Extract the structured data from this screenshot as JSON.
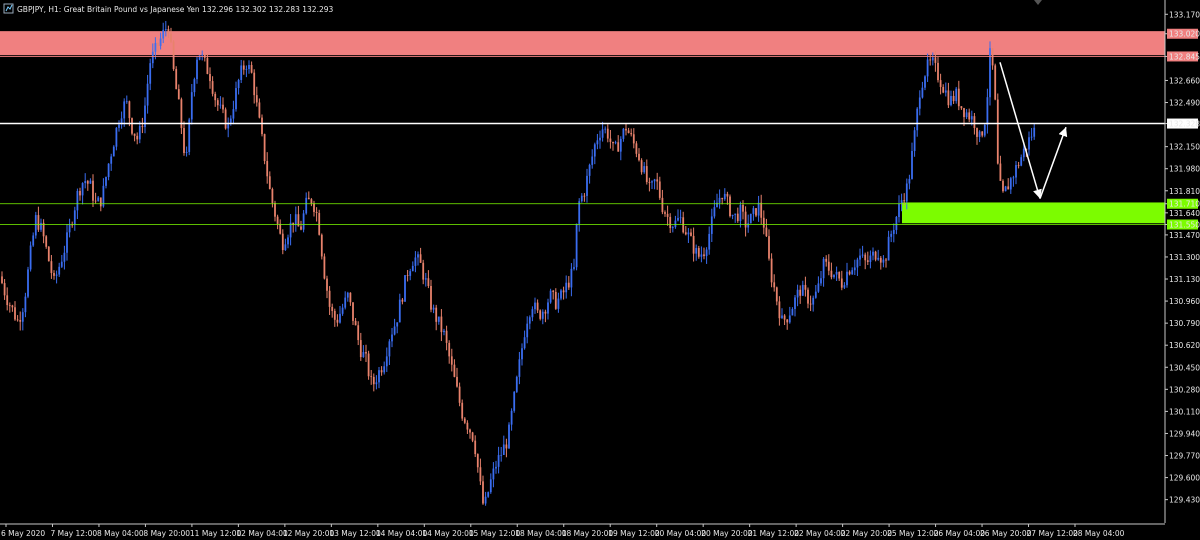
{
  "window": {
    "title": "GBPJPY, H1:  Great Britain Pound vs Japanese Yen  132.296 132.302 132.283 132.293"
  },
  "colors": {
    "background": "#000000",
    "bull_candle": "#3a6df0",
    "bear_candle": "#e8826c",
    "resistance_zone": "#f08080",
    "support_zone": "#7cfc00",
    "current_price_line": "#ffffff",
    "axis_text": "#e8e8e8",
    "axis_line": "#c8c8c8"
  },
  "chart_data": {
    "type": "candlestick",
    "title": "GBPJPY, H1:  Great Britain Pound vs Japanese Yen  132.296 132.302 132.283 132.293",
    "xlabel": "",
    "ylabel": "",
    "ylim": [
      129.25,
      133.28
    ],
    "y_ticks": [
      "133.170",
      "133.020",
      "132.845",
      "132.660",
      "132.490",
      "132.328",
      "132.150",
      "131.980",
      "131.810",
      "131.710",
      "131.640",
      "131.550",
      "131.470",
      "131.300",
      "131.130",
      "130.960",
      "130.790",
      "130.620",
      "130.450",
      "130.280",
      "130.110",
      "129.940",
      "129.770",
      "129.600",
      "129.430"
    ],
    "y_tick_values": [
      133.17,
      133.02,
      132.845,
      132.66,
      132.49,
      132.328,
      132.15,
      131.98,
      131.81,
      131.71,
      131.64,
      131.55,
      131.47,
      131.3,
      131.13,
      130.96,
      130.79,
      130.62,
      130.45,
      130.28,
      130.11,
      129.94,
      129.77,
      129.6,
      129.43
    ],
    "x_ticks": [
      "6 May 2020",
      "7 May 12:00",
      "8 May 04:00",
      "8 May 20:00",
      "11 May 12:00",
      "12 May 04:00",
      "12 May 20:00",
      "13 May 12:00",
      "14 May 04:00",
      "14 May 20:00",
      "15 May 12:00",
      "18 May 04:00",
      "18 May 20:00",
      "19 May 12:00",
      "20 May 04:00",
      "20 May 20:00",
      "21 May 12:00",
      "22 May 04:00",
      "22 May 20:00",
      "25 May 12:00",
      "26 May 04:00",
      "26 May 20:00",
      "27 May 12:00",
      "28 May 04:00"
    ],
    "close_path": [
      [
        0,
        131.15
      ],
      [
        6,
        131.0
      ],
      [
        12,
        130.9
      ],
      [
        18,
        130.8
      ],
      [
        24,
        130.95
      ],
      [
        30,
        131.3
      ],
      [
        36,
        131.6
      ],
      [
        42,
        131.5
      ],
      [
        48,
        131.3
      ],
      [
        54,
        131.1
      ],
      [
        60,
        131.25
      ],
      [
        66,
        131.4
      ],
      [
        72,
        131.6
      ],
      [
        78,
        131.8
      ],
      [
        84,
        131.9
      ],
      [
        90,
        131.85
      ],
      [
        96,
        131.7
      ],
      [
        102,
        131.75
      ],
      [
        108,
        132.0
      ],
      [
        114,
        132.2
      ],
      [
        120,
        132.4
      ],
      [
        126,
        132.5
      ],
      [
        132,
        132.3
      ],
      [
        138,
        132.2
      ],
      [
        144,
        132.4
      ],
      [
        150,
        132.8
      ],
      [
        156,
        132.9
      ],
      [
        162,
        133.0
      ],
      [
        168,
        133.1
      ],
      [
        174,
        132.7
      ],
      [
        180,
        132.4
      ],
      [
        186,
        132.0
      ],
      [
        192,
        132.6
      ],
      [
        198,
        132.9
      ],
      [
        204,
        132.8
      ],
      [
        210,
        132.7
      ],
      [
        216,
        132.5
      ],
      [
        222,
        132.4
      ],
      [
        228,
        132.3
      ],
      [
        234,
        132.5
      ],
      [
        240,
        132.7
      ],
      [
        246,
        132.8
      ],
      [
        252,
        132.7
      ],
      [
        258,
        132.4
      ],
      [
        264,
        132.1
      ],
      [
        270,
        131.8
      ],
      [
        276,
        131.6
      ],
      [
        282,
        131.4
      ],
      [
        288,
        131.5
      ],
      [
        294,
        131.6
      ],
      [
        300,
        131.5
      ],
      [
        306,
        131.7
      ],
      [
        312,
        131.75
      ],
      [
        318,
        131.6
      ],
      [
        324,
        131.2
      ],
      [
        330,
        130.9
      ],
      [
        336,
        130.8
      ],
      [
        342,
        130.9
      ],
      [
        348,
        131.0
      ],
      [
        354,
        130.8
      ],
      [
        360,
        130.6
      ],
      [
        366,
        130.5
      ],
      [
        372,
        130.3
      ],
      [
        378,
        130.4
      ],
      [
        384,
        130.5
      ],
      [
        390,
        130.7
      ],
      [
        396,
        130.8
      ],
      [
        402,
        131.0
      ],
      [
        408,
        131.2
      ],
      [
        414,
        131.3
      ],
      [
        420,
        131.25
      ],
      [
        426,
        131.1
      ],
      [
        432,
        130.9
      ],
      [
        438,
        130.8
      ],
      [
        444,
        130.7
      ],
      [
        450,
        130.5
      ],
      [
        456,
        130.3
      ],
      [
        462,
        130.1
      ],
      [
        468,
        130.0
      ],
      [
        474,
        129.9
      ],
      [
        480,
        129.55
      ],
      [
        484,
        129.35
      ],
      [
        490,
        129.55
      ],
      [
        496,
        129.7
      ],
      [
        502,
        129.8
      ],
      [
        508,
        129.9
      ],
      [
        514,
        130.2
      ],
      [
        520,
        130.5
      ],
      [
        526,
        130.8
      ],
      [
        532,
        130.95
      ],
      [
        538,
        130.85
      ],
      [
        544,
        130.9
      ],
      [
        550,
        131.0
      ],
      [
        556,
        130.95
      ],
      [
        562,
        131.0
      ],
      [
        568,
        131.1
      ],
      [
        574,
        131.2
      ],
      [
        578,
        131.7
      ],
      [
        584,
        131.8
      ],
      [
        590,
        132.0
      ],
      [
        596,
        132.2
      ],
      [
        602,
        132.3
      ],
      [
        608,
        132.25
      ],
      [
        614,
        132.1
      ],
      [
        620,
        132.2
      ],
      [
        626,
        132.3
      ],
      [
        632,
        132.2
      ],
      [
        638,
        132.1
      ],
      [
        644,
        131.95
      ],
      [
        650,
        131.8
      ],
      [
        656,
        131.9
      ],
      [
        662,
        131.7
      ],
      [
        668,
        131.6
      ],
      [
        674,
        131.55
      ],
      [
        680,
        131.6
      ],
      [
        686,
        131.5
      ],
      [
        692,
        131.4
      ],
      [
        698,
        131.3
      ],
      [
        704,
        131.35
      ],
      [
        710,
        131.5
      ],
      [
        716,
        131.7
      ],
      [
        722,
        131.8
      ],
      [
        728,
        131.7
      ],
      [
        734,
        131.6
      ],
      [
        740,
        131.65
      ],
      [
        746,
        131.55
      ],
      [
        752,
        131.6
      ],
      [
        758,
        131.7
      ],
      [
        764,
        131.55
      ],
      [
        770,
        131.2
      ],
      [
        776,
        131.0
      ],
      [
        782,
        130.8
      ],
      [
        788,
        130.85
      ],
      [
        794,
        130.95
      ],
      [
        800,
        131.05
      ],
      [
        806,
        131.0
      ],
      [
        812,
        130.95
      ],
      [
        818,
        131.05
      ],
      [
        824,
        131.25
      ],
      [
        830,
        131.2
      ],
      [
        836,
        131.15
      ],
      [
        842,
        131.1
      ],
      [
        848,
        131.2
      ],
      [
        854,
        131.25
      ],
      [
        860,
        131.3
      ],
      [
        866,
        131.25
      ],
      [
        872,
        131.3
      ],
      [
        878,
        131.35
      ],
      [
        884,
        131.25
      ],
      [
        890,
        131.45
      ],
      [
        896,
        131.6
      ],
      [
        902,
        131.75
      ],
      [
        908,
        131.85
      ],
      [
        914,
        132.2
      ],
      [
        920,
        132.6
      ],
      [
        926,
        132.75
      ],
      [
        932,
        132.8
      ],
      [
        938,
        132.7
      ],
      [
        944,
        132.6
      ],
      [
        950,
        132.5
      ],
      [
        956,
        132.55
      ],
      [
        962,
        132.45
      ],
      [
        968,
        132.4
      ],
      [
        974,
        132.35
      ],
      [
        980,
        132.2
      ],
      [
        986,
        132.4
      ],
      [
        990,
        132.85
      ],
      [
        994,
        132.7
      ],
      [
        998,
        131.95
      ],
      [
        1002,
        131.75
      ],
      [
        1008,
        131.85
      ],
      [
        1014,
        131.95
      ],
      [
        1020,
        132.05
      ],
      [
        1026,
        132.15
      ],
      [
        1032,
        132.25
      ],
      [
        1036,
        132.29
      ]
    ],
    "zones": [
      {
        "label": "133.020",
        "top": 133.04,
        "bottom": 132.855,
        "color": "#f08080"
      },
      {
        "label": "131.710",
        "top": 131.72,
        "bottom": 131.56,
        "color": "#7cfc00"
      }
    ],
    "price_lines": [
      {
        "label": "132.328",
        "value": 132.328,
        "color": "#ffffff"
      },
      {
        "label": "132.845",
        "value": 132.845,
        "color": "#f08080"
      },
      {
        "label": "131.710",
        "value": 131.71,
        "color": "#7cfc00"
      },
      {
        "label": "131.550",
        "value": 131.55,
        "color": "#7cfc00"
      }
    ],
    "grid": false,
    "annotations": [
      {
        "type": "arrow",
        "from": [
          1000,
          132.8
        ],
        "to": [
          1040,
          131.75
        ],
        "color": "#ffffff"
      },
      {
        "type": "arrow",
        "from": [
          1040,
          131.75
        ],
        "to": [
          1066,
          132.3
        ],
        "color": "#ffffff"
      }
    ]
  }
}
